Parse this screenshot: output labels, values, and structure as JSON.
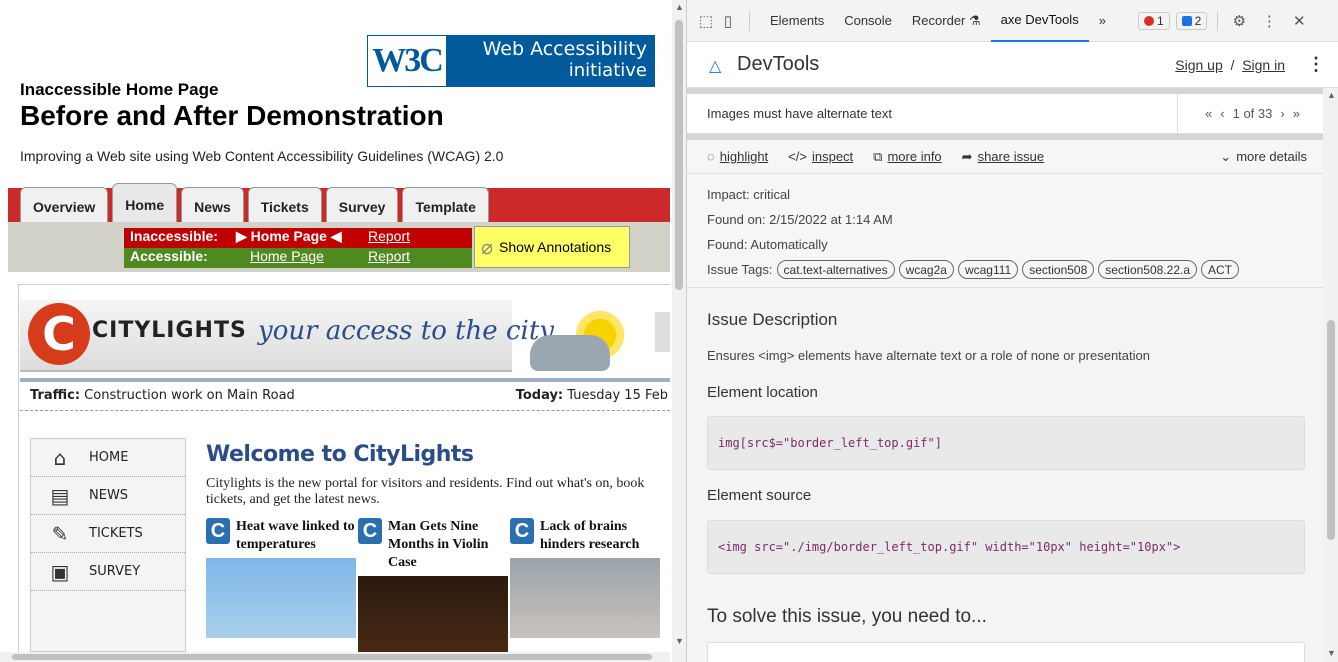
{
  "left": {
    "w3c": {
      "logo": "W3C",
      "title1": "Web Accessibility",
      "title2": "initiative"
    },
    "sub_heading": "Inaccessible Home Page",
    "title": "Before and After Demonstration",
    "description": "Improving a Web site using Web Content Accessibility Guidelines (WCAG) 2.0",
    "tabs": [
      "Overview",
      "Home",
      "News",
      "Tickets",
      "Survey",
      "Template"
    ],
    "active_tab": "Home",
    "subnav": {
      "inaccessible_label": "Inaccessible:",
      "inaccessible_page": "▶ Home Page ◀",
      "inaccessible_report": "Report",
      "accessible_label": "Accessible:",
      "accessible_page": "Home Page",
      "accessible_report": "Report"
    },
    "annotations": "Show Annotations",
    "site_name": "CITYLIGHTS",
    "tagline": "your access to the city",
    "traffic_label": "Traffic:",
    "traffic_text": "Construction work on Main Road",
    "today_label": "Today:",
    "today_text": "Tuesday 15 Feb",
    "sidenav": [
      "HOME",
      "NEWS",
      "TICKETS",
      "SURVEY"
    ],
    "welcome": "Welcome to CityLights",
    "intro": "Citylights is the new portal for visitors and residents. Find out what's on, book tickets, and get the latest news.",
    "news": [
      {
        "title": "Heat wave linked to temperatures"
      },
      {
        "title": "Man Gets Nine Months in Violin Case"
      },
      {
        "title": "Lack of brains hinders research"
      }
    ]
  },
  "devtools": {
    "tabs": [
      "Elements",
      "Console",
      "Recorder",
      "axe DevTools"
    ],
    "active_tab": "axe DevTools",
    "overflow": "»",
    "errors": "1",
    "messages": "2",
    "axe_title": "DevTools",
    "sign_up": "Sign up",
    "sign_sep": "/",
    "sign_in": "Sign in",
    "issue_name": "Images must have alternate text",
    "pager": "1 of 33",
    "actions": {
      "highlight": "highlight",
      "inspect": "inspect",
      "more_info": "more info",
      "share_issue": "share issue",
      "more_details": "more details"
    },
    "impact": "Impact: critical",
    "found_on": "Found on: 2/15/2022 at 1:14 AM",
    "found_how": "Found: Automatically",
    "tags_label": "Issue Tags:",
    "tags": [
      "cat.text-alternatives",
      "wcag2a",
      "wcag111",
      "section508",
      "section508.22.a",
      "ACT"
    ],
    "issue_description_heading": "Issue Description",
    "issue_description": "Ensures <img> elements have alternate text or a role of none or presentation",
    "element_location_heading": "Element location",
    "element_location": "img[src$=\"border_left_top.gif\"]",
    "element_source_heading": "Element source",
    "element_source": "<img src=\"./img/border_left_top.gif\" width=\"10px\" height=\"10px\">",
    "solve_heading": "To solve this issue, you need to..."
  }
}
